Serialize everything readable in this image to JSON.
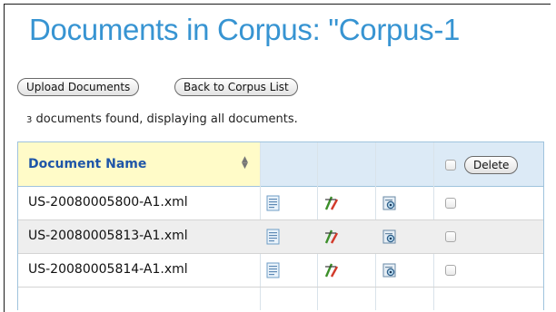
{
  "page": {
    "title": "Documents in Corpus: \"Corpus-1"
  },
  "toolbar": {
    "upload_label": "Upload Documents",
    "back_label": "Back to Corpus List"
  },
  "summary": {
    "count": "3",
    "text": " documents found, displaying all documents."
  },
  "table": {
    "column_header": "Document Name",
    "delete_label": "Delete",
    "rows": [
      {
        "name": "US-20080005800-A1.xml",
        "icons": [
          "document-icon",
          "edit-icon",
          "preview-icon"
        ]
      },
      {
        "name": "US-20080005813-A1.xml",
        "icons": [
          "document-icon",
          "edit-icon",
          "preview-icon"
        ]
      },
      {
        "name": "US-20080005814-A1.xml",
        "icons": [
          "document-icon",
          "edit-icon",
          "preview-icon"
        ]
      }
    ]
  },
  "colors": {
    "title": "#3794d2",
    "header_bg": "#dceaf6",
    "sorted_header_bg": "#fffbc8",
    "header_text": "#1f56a8"
  }
}
